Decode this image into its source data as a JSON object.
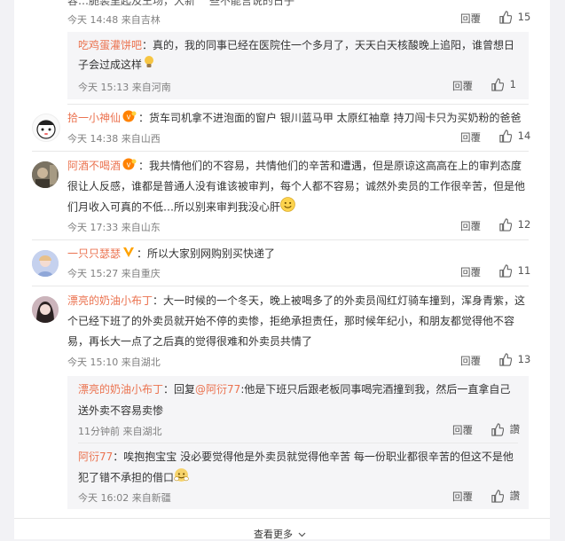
{
  "comments": [
    {
      "top_fragment": "容…脆装里起及王场，大新",
      "top_fragment_tail": "些不能言说的日子",
      "time": "今天 14:48 来自吉林",
      "reply_label": "回覆",
      "like_count": "15"
    },
    {
      "user": "吃鸡蛋灌饼吧",
      "text": "：真的，我的同事已经在医院住一个多月了，天天白天核酸晚上追阳，谁曾想日",
      "text2": "子会过成这样",
      "time": "今天 15:13 来自河南",
      "reply_label": "回覆",
      "like_count": "1"
    },
    {
      "user": "拾一小神仙",
      "text": "：货车司机拿不进泡面的窗户 银川蓝马甲 太原红袖章 持刀闯卡只为买奶粉的爸爸",
      "time": "今天 14:38 来自山西",
      "reply_label": "回覆",
      "like_count": "14"
    },
    {
      "user": "阿酒不喝酒",
      "text": "：我共情他们的不容易，共情他们的辛苦和遭遇，但是原谅这高高在上的审判态度",
      "text2": "很让人反感，谁都是普通人没有谁该被审判，每个人都不容易；诚然外卖员的工作很辛苦，但是他",
      "text3": "们月收入可真的不低…所以别来审判我没心肝",
      "time": "今天 17:33 来自山东",
      "reply_label": "回覆",
      "like_count": "12"
    },
    {
      "user": "一只只瑟瑟",
      "text": "：所以大家别网购别买快递了",
      "time": "今天 15:27 来自重庆",
      "reply_label": "回覆",
      "like_count": "11"
    },
    {
      "user": "漂亮的奶油小布丁",
      "text": "：大一时候的一个冬天，晚上被喝多了的外卖员闯红灯骑车撞到，浑身青紫，这",
      "text2": "个已经下班了的外卖员就开始不停的卖惨，拒绝承担责任，那时候年纪小，和朋友都觉得他不容",
      "text3": "易，再长大一点了之后真的觉得很难和外卖员共情了",
      "time": "今天 15:10 来自湖北",
      "reply_label": "回覆",
      "like_count": "13"
    }
  ],
  "sub_replies": [
    {
      "user": "漂亮的奶油小布丁",
      "prefix": "：回复",
      "mention": "@阿衍77",
      "text": ":他是下班只后跟老板同事喝完酒撞到我，然后一直拿自己",
      "text2": "送外卖不容易卖惨",
      "time": "11分钟前 来自湖北",
      "reply_label": "回覆",
      "like_label": "讚"
    },
    {
      "user": "阿衍77",
      "text": "：唉抱抱宝宝 没必要觉得他是外卖员就觉得他辛苦 每一份职业都很辛苦的但这不是他",
      "text2": "犯了错不承担的借口",
      "time": "今天 16:02 来自新疆",
      "reply_label": "回覆",
      "like_label": "讚"
    }
  ],
  "footer": {
    "more_label": "查看更多"
  },
  "colors": {
    "username": "#eb7350",
    "vip_badge": "#ff8200",
    "bg": "#f2f2f5"
  }
}
